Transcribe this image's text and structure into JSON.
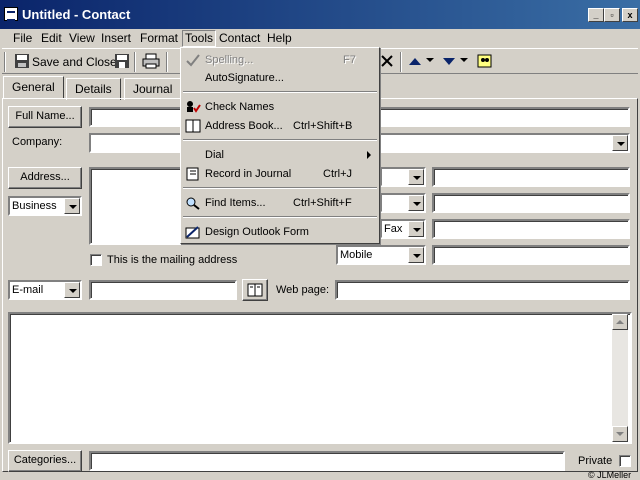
{
  "window": {
    "title": "Untitled - Contact",
    "minimize": "_",
    "restore": "▫",
    "close": "x"
  },
  "menubar": {
    "items": [
      "File",
      "Edit",
      "View",
      "Insert",
      "Format",
      "Tools",
      "Contact",
      "Help"
    ]
  },
  "toolbar": {
    "save_close": "Save and Close"
  },
  "tabs": [
    "General",
    "Details",
    "Journal"
  ],
  "tools_menu": {
    "spelling": "Spelling...",
    "spelling_shortcut": "F7",
    "autosignature": "AutoSignature...",
    "check_names": "Check Names",
    "address_book": "Address Book...",
    "address_book_shortcut": "Ctrl+Shift+B",
    "dial": "Dial",
    "record_journal": "Record in Journal",
    "record_journal_shortcut": "Ctrl+J",
    "find_items": "Find Items...",
    "find_items_shortcut": "Ctrl+Shift+F",
    "design_form": "Design Outlook Form"
  },
  "form": {
    "full_name_button": "Full Name...",
    "company_label": "Company:",
    "address_button": "Address...",
    "address_type": "Business",
    "mailing_checkbox": "This is the mailing address",
    "phone_fax": "Fax",
    "phone_mobile": "Mobile",
    "email_type": "E-mail",
    "web_page_label": "Web page:",
    "categories_button": "Categories...",
    "private_label": "Private"
  },
  "watermark": "© JLMeller"
}
